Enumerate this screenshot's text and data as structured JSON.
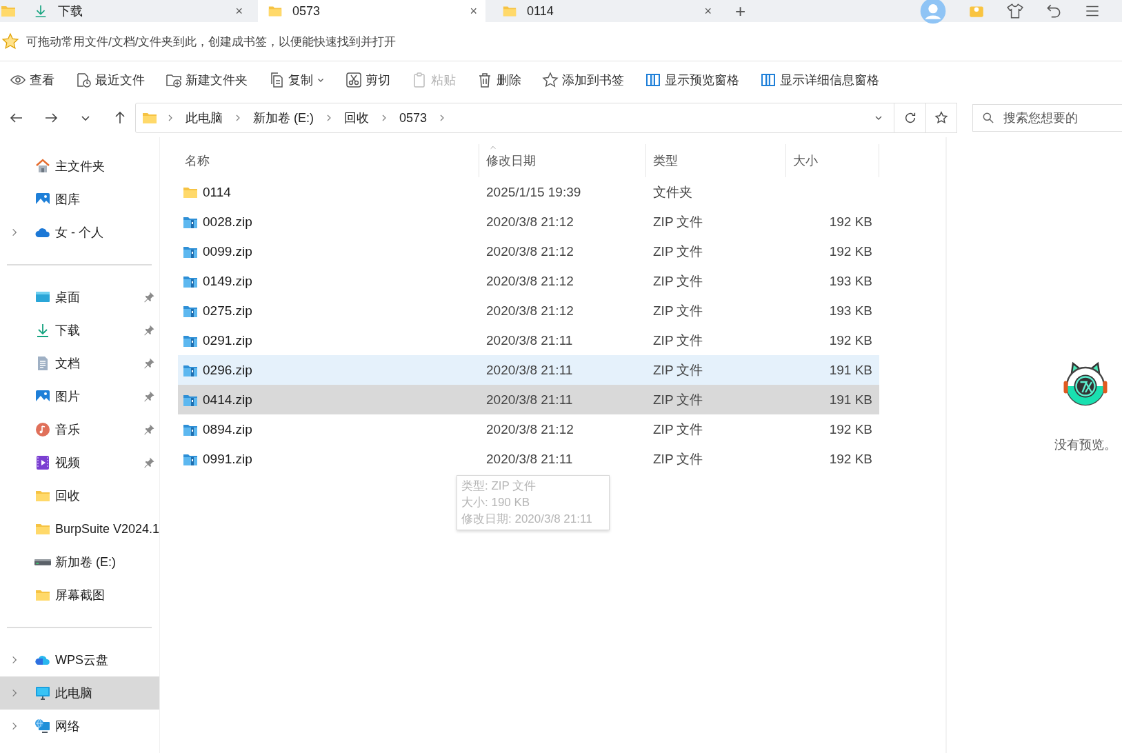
{
  "tabs": [
    {
      "label": "下载",
      "kind": "download",
      "close": "×",
      "selected": false
    },
    {
      "label": "0573",
      "kind": "folder",
      "close": "×",
      "selected": true
    },
    {
      "label": "0114",
      "kind": "folder",
      "close": "×",
      "selected": false
    }
  ],
  "new_tab": "+",
  "bookmark_hint": "可拖动常用文件/文档/文件夹到此，创建成书签，以便能快速找到并打开",
  "toolbar": [
    {
      "label": "查看",
      "kind": "eye",
      "disabled": false,
      "dropdown": false
    },
    {
      "label": "最近文件",
      "kind": "recent",
      "disabled": false,
      "dropdown": false
    },
    {
      "label": "新建文件夹",
      "kind": "newfolder",
      "disabled": false,
      "dropdown": false
    },
    {
      "label": "复制",
      "kind": "copy",
      "disabled": false,
      "dropdown": true
    },
    {
      "label": "剪切",
      "kind": "cut",
      "disabled": false,
      "dropdown": false
    },
    {
      "label": "粘贴",
      "kind": "paste",
      "disabled": true,
      "dropdown": false
    },
    {
      "label": "删除",
      "kind": "delete",
      "disabled": false,
      "dropdown": false
    },
    {
      "label": "添加到书签",
      "kind": "star",
      "disabled": false,
      "dropdown": false
    },
    {
      "label": "显示预览窗格",
      "kind": "pane",
      "disabled": false,
      "dropdown": false
    },
    {
      "label": "显示详细信息窗格",
      "kind": "pane",
      "disabled": false,
      "dropdown": false
    }
  ],
  "address": {
    "path": [
      "此电脑",
      "新加卷 (E:)",
      "回收",
      "0573"
    ],
    "search_placeholder": "搜索您想要的"
  },
  "sidebar": {
    "groups": [
      [
        {
          "label": "主文件夹",
          "kind": "home",
          "expandable": false,
          "pinned": false,
          "selected": false
        },
        {
          "label": "图库",
          "kind": "gallery",
          "expandable": false,
          "pinned": false,
          "selected": false
        },
        {
          "label": "女 - 个人",
          "kind": "cloud",
          "expandable": true,
          "pinned": false,
          "selected": false
        }
      ],
      [
        {
          "label": "桌面",
          "kind": "desktop",
          "expandable": false,
          "pinned": true,
          "selected": false
        },
        {
          "label": "下载",
          "kind": "download",
          "expandable": false,
          "pinned": true,
          "selected": false
        },
        {
          "label": "文档",
          "kind": "document",
          "expandable": false,
          "pinned": true,
          "selected": false
        },
        {
          "label": "图片",
          "kind": "gallery",
          "expandable": false,
          "pinned": true,
          "selected": false
        },
        {
          "label": "音乐",
          "kind": "music",
          "expandable": false,
          "pinned": true,
          "selected": false
        },
        {
          "label": "视频",
          "kind": "video",
          "expandable": false,
          "pinned": true,
          "selected": false
        },
        {
          "label": "回收",
          "kind": "folder",
          "expandable": false,
          "pinned": false,
          "selected": false
        },
        {
          "label": "BurpSuite V2024.1",
          "kind": "folder",
          "expandable": false,
          "pinned": false,
          "selected": false
        },
        {
          "label": "新加卷 (E:)",
          "kind": "drive",
          "expandable": false,
          "pinned": false,
          "selected": false
        },
        {
          "label": "屏幕截图",
          "kind": "folder",
          "expandable": false,
          "pinned": false,
          "selected": false
        }
      ],
      [
        {
          "label": "WPS云盘",
          "kind": "wpscloud",
          "expandable": true,
          "pinned": false,
          "selected": false
        },
        {
          "label": "此电脑",
          "kind": "pc",
          "expandable": true,
          "pinned": false,
          "selected": true
        },
        {
          "label": "网络",
          "kind": "network",
          "expandable": true,
          "pinned": false,
          "selected": false
        }
      ]
    ]
  },
  "file_list": {
    "columns": [
      "名称",
      "修改日期",
      "类型",
      "大小"
    ],
    "rows": [
      {
        "name": "0114",
        "date": "2025/1/15 19:39",
        "type": "文件夹",
        "kind": "folder",
        "hovered": false,
        "selected": false
      },
      {
        "name": "0028.zip",
        "date": "2020/3/8 21:12",
        "type": "ZIP 文件",
        "size": "192 KB",
        "kind": "zip",
        "hovered": false,
        "selected": false
      },
      {
        "name": "0099.zip",
        "date": "2020/3/8 21:12",
        "type": "ZIP 文件",
        "size": "192 KB",
        "kind": "zip",
        "hovered": false,
        "selected": false
      },
      {
        "name": "0149.zip",
        "date": "2020/3/8 21:12",
        "type": "ZIP 文件",
        "size": "193 KB",
        "kind": "zip",
        "hovered": false,
        "selected": false
      },
      {
        "name": "0275.zip",
        "date": "2020/3/8 21:12",
        "type": "ZIP 文件",
        "size": "193 KB",
        "kind": "zip",
        "hovered": false,
        "selected": false
      },
      {
        "name": "0291.zip",
        "date": "2020/3/8 21:11",
        "type": "ZIP 文件",
        "size": "192 KB",
        "kind": "zip",
        "hovered": false,
        "selected": false
      },
      {
        "name": "0296.zip",
        "date": "2020/3/8 21:11",
        "type": "ZIP 文件",
        "size": "191 KB",
        "kind": "zip",
        "hovered": true,
        "selected": false
      },
      {
        "name": "0414.zip",
        "date": "2020/3/8 21:11",
        "type": "ZIP 文件",
        "size": "191 KB",
        "kind": "zip",
        "hovered": false,
        "selected": true
      },
      {
        "name": "0894.zip",
        "date": "2020/3/8 21:12",
        "type": "ZIP 文件",
        "size": "192 KB",
        "kind": "zip",
        "hovered": false,
        "selected": false
      },
      {
        "name": "0991.zip",
        "date": "2020/3/8 21:11",
        "type": "ZIP 文件",
        "size": "192 KB",
        "kind": "zip",
        "hovered": false,
        "selected": false
      }
    ],
    "tooltip": {
      "lines": [
        "类型: ZIP 文件",
        "大小: 190 KB",
        "修改日期: 2020/3/8 21:11"
      ]
    }
  },
  "preview": {
    "message": "没有预览。"
  }
}
